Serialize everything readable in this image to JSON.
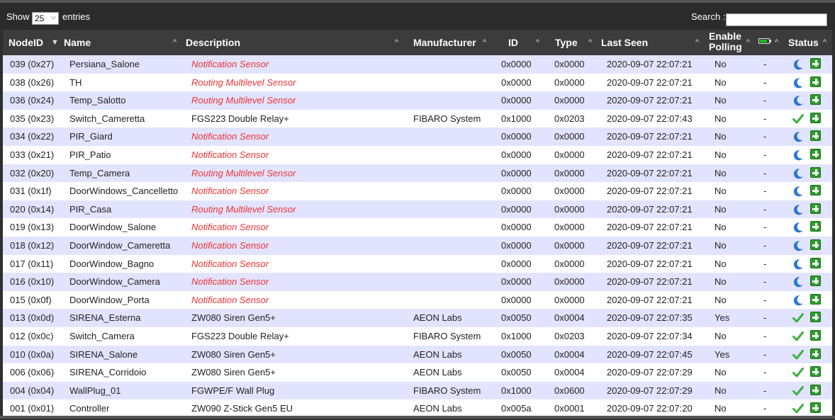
{
  "controls": {
    "show_label": "Show",
    "entries_value": "25",
    "entries_label": "entries",
    "search_label": "Search :",
    "search_value": ""
  },
  "columns": {
    "nodeid": "NodeID",
    "name": "Name",
    "description": "Description",
    "manufacturer": "Manufacturer",
    "id": "ID",
    "type": "Type",
    "last_seen": "Last Seen",
    "enable_polling_1": "Enable",
    "enable_polling_2": "Polling",
    "battery_icon": "battery-icon",
    "status": "Status"
  },
  "rows": [
    {
      "nodeid": "039 (0x27)",
      "name": "Persiana_Salone",
      "description": "Notification Sensor",
      "desc_style": "red",
      "manufacturer": "",
      "id": "0x0000",
      "type": "0x0000",
      "last_seen": "2020-09-07 22:07:21",
      "polling": "No",
      "battery": "-",
      "status": "sleeping"
    },
    {
      "nodeid": "038 (0x26)",
      "name": "TH",
      "description": "Routing Multilevel Sensor",
      "desc_style": "red",
      "manufacturer": "",
      "id": "0x0000",
      "type": "0x0000",
      "last_seen": "2020-09-07 22:07:21",
      "polling": "No",
      "battery": "-",
      "status": "sleeping"
    },
    {
      "nodeid": "036 (0x24)",
      "name": "Temp_Salotto",
      "description": "Routing Multilevel Sensor",
      "desc_style": "red",
      "manufacturer": "",
      "id": "0x0000",
      "type": "0x0000",
      "last_seen": "2020-09-07 22:07:21",
      "polling": "No",
      "battery": "-",
      "status": "sleeping"
    },
    {
      "nodeid": "035 (0x23)",
      "name": "Switch_Cameretta",
      "description": "FGS223 Double Relay+",
      "desc_style": "normal",
      "manufacturer": "FIBARO System",
      "id": "0x1000",
      "type": "0x0203",
      "last_seen": "2020-09-07 22:07:43",
      "polling": "No",
      "battery": "-",
      "status": "ok"
    },
    {
      "nodeid": "034 (0x22)",
      "name": "PIR_Giard",
      "description": "Notification Sensor",
      "desc_style": "red",
      "manufacturer": "",
      "id": "0x0000",
      "type": "0x0000",
      "last_seen": "2020-09-07 22:07:21",
      "polling": "No",
      "battery": "-",
      "status": "sleeping"
    },
    {
      "nodeid": "033 (0x21)",
      "name": "PIR_Patio",
      "description": "Notification Sensor",
      "desc_style": "red",
      "manufacturer": "",
      "id": "0x0000",
      "type": "0x0000",
      "last_seen": "2020-09-07 22:07:21",
      "polling": "No",
      "battery": "-",
      "status": "sleeping"
    },
    {
      "nodeid": "032 (0x20)",
      "name": "Temp_Camera",
      "description": "Routing Multilevel Sensor",
      "desc_style": "red",
      "manufacturer": "",
      "id": "0x0000",
      "type": "0x0000",
      "last_seen": "2020-09-07 22:07:21",
      "polling": "No",
      "battery": "-",
      "status": "sleeping"
    },
    {
      "nodeid": "031 (0x1f)",
      "name": "DoorWindows_Cancelletto",
      "description": "Notification Sensor",
      "desc_style": "red",
      "manufacturer": "",
      "id": "0x0000",
      "type": "0x0000",
      "last_seen": "2020-09-07 22:07:21",
      "polling": "No",
      "battery": "-",
      "status": "sleeping"
    },
    {
      "nodeid": "020 (0x14)",
      "name": "PIR_Casa",
      "description": "Routing Multilevel Sensor",
      "desc_style": "red",
      "manufacturer": "",
      "id": "0x0000",
      "type": "0x0000",
      "last_seen": "2020-09-07 22:07:21",
      "polling": "No",
      "battery": "-",
      "status": "sleeping"
    },
    {
      "nodeid": "019 (0x13)",
      "name": "DoorWindow_Salone",
      "description": "Notification Sensor",
      "desc_style": "red",
      "manufacturer": "",
      "id": "0x0000",
      "type": "0x0000",
      "last_seen": "2020-09-07 22:07:21",
      "polling": "No",
      "battery": "-",
      "status": "sleeping"
    },
    {
      "nodeid": "018 (0x12)",
      "name": "DoorWindow_Cameretta",
      "description": "Notification Sensor",
      "desc_style": "red",
      "manufacturer": "",
      "id": "0x0000",
      "type": "0x0000",
      "last_seen": "2020-09-07 22:07:21",
      "polling": "No",
      "battery": "-",
      "status": "sleeping"
    },
    {
      "nodeid": "017 (0x11)",
      "name": "DoorWindow_Bagno",
      "description": "Notification Sensor",
      "desc_style": "red",
      "manufacturer": "",
      "id": "0x0000",
      "type": "0x0000",
      "last_seen": "2020-09-07 22:07:21",
      "polling": "No",
      "battery": "-",
      "status": "sleeping"
    },
    {
      "nodeid": "016 (0x10)",
      "name": "DoorWindow_Camera",
      "description": "Notification Sensor",
      "desc_style": "red",
      "manufacturer": "",
      "id": "0x0000",
      "type": "0x0000",
      "last_seen": "2020-09-07 22:07:21",
      "polling": "No",
      "battery": "-",
      "status": "sleeping"
    },
    {
      "nodeid": "015 (0x0f)",
      "name": "DoorWindow_Porta",
      "description": "Notification Sensor",
      "desc_style": "red",
      "manufacturer": "",
      "id": "0x0000",
      "type": "0x0000",
      "last_seen": "2020-09-07 22:07:21",
      "polling": "No",
      "battery": "-",
      "status": "sleeping"
    },
    {
      "nodeid": "013 (0x0d)",
      "name": "SIRENA_Esterna",
      "description": "ZW080 Siren Gen5+",
      "desc_style": "normal",
      "manufacturer": "AEON Labs",
      "id": "0x0050",
      "type": "0x0004",
      "last_seen": "2020-09-07 22:07:35",
      "polling": "Yes",
      "battery": "-",
      "status": "ok"
    },
    {
      "nodeid": "012 (0x0c)",
      "name": "Switch_Camera",
      "description": "FGS223 Double Relay+",
      "desc_style": "normal",
      "manufacturer": "FIBARO System",
      "id": "0x1000",
      "type": "0x0203",
      "last_seen": "2020-09-07 22:07:34",
      "polling": "No",
      "battery": "-",
      "status": "ok"
    },
    {
      "nodeid": "010 (0x0a)",
      "name": "SIRENA_Salone",
      "description": "ZW080 Siren Gen5+",
      "desc_style": "normal",
      "manufacturer": "AEON Labs",
      "id": "0x0050",
      "type": "0x0004",
      "last_seen": "2020-09-07 22:07:45",
      "polling": "Yes",
      "battery": "-",
      "status": "ok"
    },
    {
      "nodeid": "006 (0x06)",
      "name": "SIRENA_Corridoio",
      "description": "ZW080 Siren Gen5+",
      "desc_style": "normal",
      "manufacturer": "AEON Labs",
      "id": "0x0050",
      "type": "0x0004",
      "last_seen": "2020-09-07 22:07:29",
      "polling": "No",
      "battery": "-",
      "status": "ok"
    },
    {
      "nodeid": "004 (0x04)",
      "name": "WallPlug_01",
      "description": "FGWPE/F Wall Plug",
      "desc_style": "normal",
      "manufacturer": "FIBARO System",
      "id": "0x1000",
      "type": "0x0600",
      "last_seen": "2020-09-07 22:07:29",
      "polling": "No",
      "battery": "-",
      "status": "ok"
    },
    {
      "nodeid": "001 (0x01)",
      "name": "Controller",
      "description": "ZW090 Z-Stick Gen5 EU",
      "desc_style": "normal",
      "manufacturer": "AEON Labs",
      "id": "0x005a",
      "type": "0x0001",
      "last_seen": "2020-09-07 22:07:20",
      "polling": "No",
      "battery": "-",
      "status": "ok"
    }
  ]
}
